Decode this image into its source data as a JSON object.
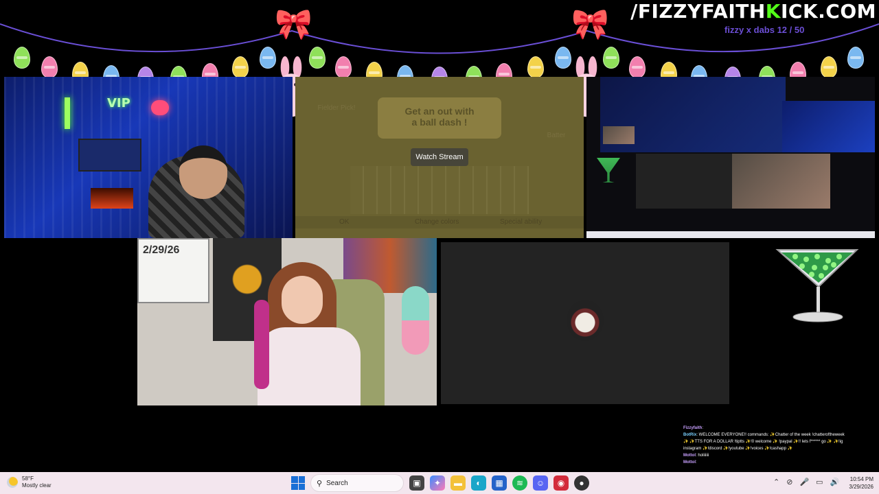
{
  "overlay": {
    "brand_prefix": "/FIZZYFAITH",
    "brand_k": "K",
    "brand_suffix": "ICK.COM",
    "goal": "fizzy x dabs 12 / 50",
    "egg_colors": [
      "#8fe05a",
      "#f27fae",
      "#f3d24a",
      "#7ab8f0",
      "#b585e8",
      "#8fe05a",
      "#f27fae",
      "#f3d24a"
    ],
    "accent_green": "#53fc18"
  },
  "cam1": {
    "neon_sign": "VIP"
  },
  "game": {
    "title_line1": "Get an out with",
    "title_line2": "a ball dash !",
    "left_label": "Fielder Pick!",
    "right_label": "Batter",
    "bottom_left": "OK",
    "bottom_mid": "Change colors",
    "bottom_right": "Special ability",
    "watch_button": "Watch Stream"
  },
  "cam2": {
    "whiteboard_text": "2/29/26"
  },
  "chat": {
    "messages": [
      {
        "user": "Fizzyfaith",
        "text": ":"
      },
      {
        "user": "BotRix",
        "text": ": WELCOME EVERYONE!! commands: ✨Chatter of the week !chatteroftheweek ✨ ✨TTS FOR A DOLLAR !tiptts ✨!0 welcome ✨ !paypal ✨!! lets f****** go ✨ ✨!ig instagram ✨!discord ✨!youtube ✨!voices ✨!cashapp ✨"
      },
      {
        "user": "Mottol",
        "text": ": holiiiiii"
      },
      {
        "user": "Mottol",
        "text": ":"
      }
    ]
  },
  "taskbar": {
    "temperature": "58°F",
    "weather": "Mostly clear",
    "search_placeholder": "Search",
    "time": "10:54 PM",
    "date": "3/29/2026"
  }
}
